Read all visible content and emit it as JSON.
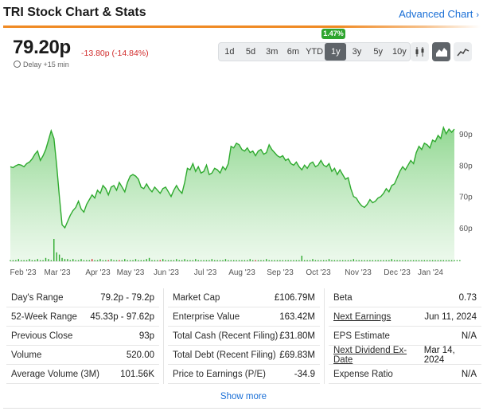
{
  "header": {
    "title": "TRI Stock Chart & Stats",
    "advanced_link": "Advanced Chart"
  },
  "quote": {
    "price": "79.20p",
    "change": "-13.80p (-14.84%)",
    "delay": "Delay +15 min"
  },
  "range_buttons": [
    "1d",
    "5d",
    "3m",
    "6m",
    "YTD",
    "1y",
    "3y",
    "5y",
    "10y"
  ],
  "active_range": "1y",
  "range_change_badge": "1.47%",
  "chart_type_buttons": [
    "candlestick-icon",
    "area-chart-icon",
    "line-chart-icon"
  ],
  "active_chart_type": "area-chart-icon",
  "colors": {
    "accent": "#f08a24",
    "line": "#2eaa2e",
    "negative": "#d12b2b",
    "link": "#1a6fd6"
  },
  "chart_data": {
    "type": "area",
    "x_labels": [
      "Feb '23",
      "Mar '23",
      "Apr '23",
      "May '23",
      "Jun '23",
      "Jul '23",
      "Aug '23",
      "Sep '23",
      "Oct '23",
      "Nov '23",
      "Dec '23",
      "Jan '24"
    ],
    "y_ticks": [
      "60p",
      "70p",
      "80p",
      "90p"
    ],
    "ylim": [
      50,
      95
    ],
    "series": [
      {
        "values": [
          79.5,
          79.2,
          79.8,
          80.2,
          80.0,
          79.5,
          80.5,
          81.0,
          82.0,
          83.5,
          84.5,
          81.5,
          83.0,
          85.0,
          88.0,
          91.0,
          88.5,
          80.0,
          70.0,
          61.0,
          60.0,
          62.0,
          64.0,
          65.5,
          66.5,
          68.5,
          66.0,
          65.0,
          67.5,
          69.0,
          70.5,
          69.5,
          72.0,
          71.0,
          73.5,
          72.5,
          70.5,
          73.0,
          73.5,
          72.0,
          74.5,
          73.0,
          71.5,
          74.5,
          76.5,
          77.0,
          76.5,
          75.5,
          73.0,
          72.5,
          74.0,
          72.5,
          71.5,
          73.0,
          72.0,
          71.0,
          72.5,
          73.0,
          71.5,
          70.0,
          72.0,
          73.5,
          72.0,
          71.0,
          74.5,
          79.0,
          78.5,
          80.5,
          78.0,
          79.5,
          77.5,
          78.0,
          80.0,
          77.0,
          77.5,
          79.0,
          78.5,
          77.5,
          79.5,
          78.5,
          80.5,
          86.0,
          85.5,
          87.0,
          86.5,
          85.0,
          84.5,
          85.5,
          84.0,
          84.5,
          83.0,
          84.5,
          85.0,
          83.5,
          84.0,
          86.5,
          85.0,
          84.0,
          83.0,
          82.5,
          83.0,
          81.5,
          82.0,
          80.5,
          80.0,
          81.0,
          79.5,
          78.5,
          80.0,
          79.0,
          80.5,
          81.0,
          79.5,
          80.0,
          81.5,
          80.0,
          79.5,
          80.5,
          78.0,
          79.0,
          77.0,
          78.5,
          77.0,
          75.5,
          76.0,
          72.5,
          70.0,
          69.5,
          68.0,
          67.0,
          66.5,
          67.5,
          69.0,
          68.0,
          68.5,
          69.5,
          70.0,
          71.0,
          72.5,
          71.5,
          73.5,
          74.0,
          76.0,
          78.0,
          79.5,
          78.5,
          80.0,
          81.5,
          80.5,
          84.0,
          86.0,
          85.0,
          87.0,
          86.5,
          85.5,
          88.0,
          87.5,
          89.5,
          88.5,
          92.0,
          90.0,
          91.5,
          90.5,
          91.5
        ]
      }
    ],
    "volume": [
      1,
      1,
      1,
      2,
      1,
      1,
      1,
      2,
      1,
      1,
      2,
      1,
      1,
      3,
      2,
      1,
      20,
      8,
      6,
      3,
      2,
      2,
      1,
      2,
      1,
      1,
      2,
      1,
      1,
      1,
      2,
      1,
      1,
      2,
      1,
      1,
      1,
      2,
      1,
      1,
      1,
      1,
      2,
      1,
      1,
      1,
      2,
      1,
      1,
      1,
      2,
      3,
      1,
      1,
      1,
      1,
      2,
      1,
      1,
      1,
      1,
      2,
      1,
      1,
      2,
      1,
      1,
      1,
      2,
      1,
      1,
      1,
      1,
      1,
      2,
      1,
      1,
      1,
      1,
      2,
      1,
      1,
      1,
      1,
      1,
      1,
      1,
      1,
      2,
      1,
      1,
      1,
      1,
      1,
      2,
      1,
      1,
      1,
      1,
      1,
      1,
      1,
      1,
      1,
      1,
      1,
      1,
      5,
      1,
      1,
      1,
      2,
      1,
      1,
      1,
      1,
      1,
      2,
      1,
      1,
      1,
      1,
      1,
      1,
      1,
      1,
      2,
      1,
      1,
      1,
      1,
      1,
      1,
      1,
      1,
      1,
      1,
      1,
      1,
      1,
      2,
      1,
      1,
      1,
      1,
      1,
      1,
      1,
      1,
      1,
      1,
      1,
      1,
      1,
      1,
      1,
      1,
      1,
      1,
      1,
      1,
      1,
      1,
      1,
      1,
      1
    ],
    "volume_red_indices": [
      30,
      36,
      40,
      55,
      90
    ]
  },
  "stats": {
    "col1": [
      {
        "label": "Day's Range",
        "value": "79.2p - 79.2p"
      },
      {
        "label": "52-Week Range",
        "value": "45.33p - 97.62p"
      },
      {
        "label": "Previous Close",
        "value": "93p"
      },
      {
        "label": "Volume",
        "value": "520.00"
      },
      {
        "label": "Average Volume (3M)",
        "value": "101.56K"
      }
    ],
    "col2": [
      {
        "label": "Market Cap",
        "value": "£106.79M"
      },
      {
        "label": "Enterprise Value",
        "value": "163.42M"
      },
      {
        "label": "Total Cash (Recent Filing)",
        "value": "£31.80M"
      },
      {
        "label": "Total Debt (Recent Filing)",
        "value": "£69.83M"
      },
      {
        "label": "Price to Earnings (P/E)",
        "value": "-34.9"
      }
    ],
    "col3": [
      {
        "label": "Beta",
        "value": "0.73"
      },
      {
        "label": "Next Earnings",
        "value": "Jun 11, 2024"
      },
      {
        "label": "EPS Estimate",
        "value": "N/A"
      },
      {
        "label": "Next Dividend Ex-Date",
        "value": "Mar 14, 2024"
      },
      {
        "label": "Expense Ratio",
        "value": "N/A"
      }
    ]
  },
  "show_more": "Show more"
}
